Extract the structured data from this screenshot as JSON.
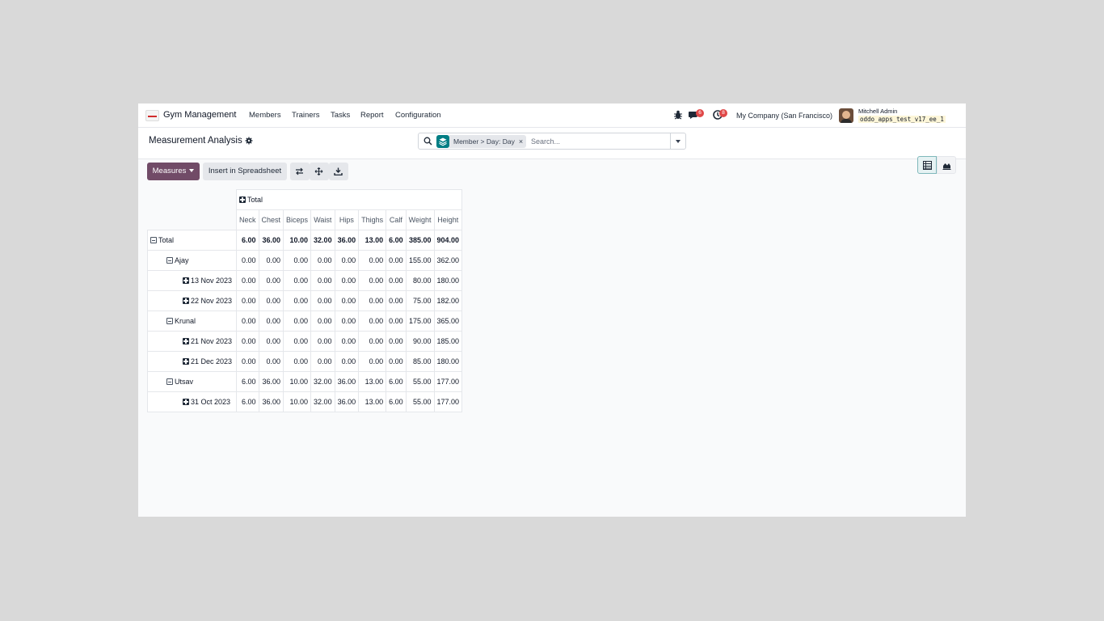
{
  "navbar": {
    "app_name": "Gym Management",
    "menus": [
      "Members",
      "Trainers",
      "Tasks",
      "Report",
      "Configuration"
    ],
    "icons": [
      "bug-icon",
      "chat-icon",
      "activity-clock-icon"
    ],
    "messages_badge": "6",
    "activities_badge": "8",
    "company": "My Company (San Francisco)",
    "user_name": "Mitchell Admin",
    "database": "oddo_apps_test_v17_ee_1",
    "accent_color": "#714b67"
  },
  "control_panel": {
    "title": "Measurement Analysis",
    "search": {
      "facet": "Member > Day: Day",
      "placeholder": "Search..."
    },
    "views": [
      "pivot",
      "graph"
    ],
    "active_view": "pivot"
  },
  "toolbar": {
    "measures_label": "Measures",
    "insert_label": "Insert in Spreadsheet",
    "icons": [
      "flip-axis-icon",
      "expand-all-icon",
      "download-icon"
    ]
  },
  "pivot": {
    "col_header": "Total",
    "measures": [
      "Neck",
      "Chest",
      "Biceps",
      "Waist",
      "Hips",
      "Thighs",
      "Calf",
      "Weight",
      "Height"
    ],
    "rows": [
      {
        "label": "Total",
        "level": 0,
        "icon": "minus",
        "bold": true,
        "values": [
          "6.00",
          "36.00",
          "10.00",
          "32.00",
          "36.00",
          "13.00",
          "6.00",
          "385.00",
          "904.00"
        ]
      },
      {
        "label": "Ajay",
        "level": 1,
        "icon": "minus",
        "bold": false,
        "values": [
          "0.00",
          "0.00",
          "0.00",
          "0.00",
          "0.00",
          "0.00",
          "0.00",
          "155.00",
          "362.00"
        ]
      },
      {
        "label": "13 Nov 2023",
        "level": 2,
        "icon": "plus",
        "bold": false,
        "values": [
          "0.00",
          "0.00",
          "0.00",
          "0.00",
          "0.00",
          "0.00",
          "0.00",
          "80.00",
          "180.00"
        ]
      },
      {
        "label": "22 Nov 2023",
        "level": 2,
        "icon": "plus",
        "bold": false,
        "values": [
          "0.00",
          "0.00",
          "0.00",
          "0.00",
          "0.00",
          "0.00",
          "0.00",
          "75.00",
          "182.00"
        ]
      },
      {
        "label": "Krunal",
        "level": 1,
        "icon": "minus",
        "bold": false,
        "values": [
          "0.00",
          "0.00",
          "0.00",
          "0.00",
          "0.00",
          "0.00",
          "0.00",
          "175.00",
          "365.00"
        ]
      },
      {
        "label": "21 Nov 2023",
        "level": 2,
        "icon": "plus",
        "bold": false,
        "values": [
          "0.00",
          "0.00",
          "0.00",
          "0.00",
          "0.00",
          "0.00",
          "0.00",
          "90.00",
          "185.00"
        ]
      },
      {
        "label": "21 Dec 2023",
        "level": 2,
        "icon": "plus",
        "bold": false,
        "values": [
          "0.00",
          "0.00",
          "0.00",
          "0.00",
          "0.00",
          "0.00",
          "0.00",
          "85.00",
          "180.00"
        ]
      },
      {
        "label": "Utsav",
        "level": 1,
        "icon": "minus",
        "bold": false,
        "values": [
          "6.00",
          "36.00",
          "10.00",
          "32.00",
          "36.00",
          "13.00",
          "6.00",
          "55.00",
          "177.00"
        ]
      },
      {
        "label": "31 Oct 2023",
        "level": 2,
        "icon": "plus",
        "bold": false,
        "values": [
          "6.00",
          "36.00",
          "10.00",
          "32.00",
          "36.00",
          "13.00",
          "6.00",
          "55.00",
          "177.00"
        ]
      }
    ]
  }
}
